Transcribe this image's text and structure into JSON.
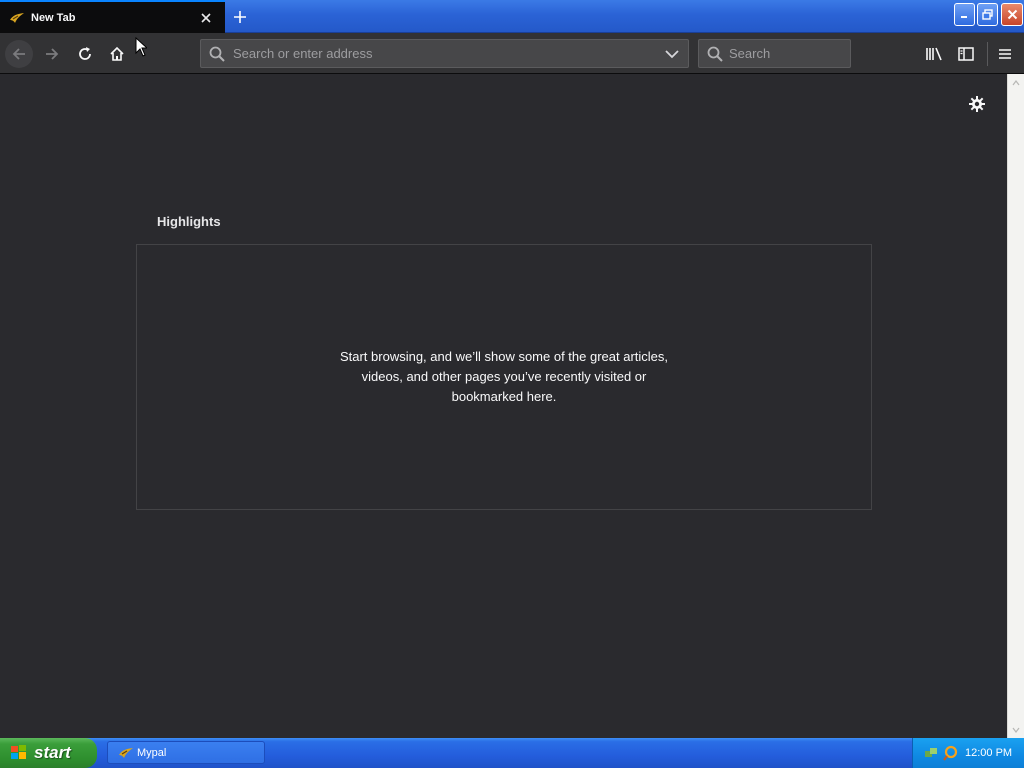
{
  "browser": {
    "tab": {
      "title": "New Tab",
      "close_glyph": "✕"
    },
    "newtab_glyph": "+",
    "urlbar": {
      "placeholder": "Search or enter address",
      "value": ""
    },
    "searchbar": {
      "placeholder": "Search",
      "value": ""
    },
    "icons": [
      "back-arrow-icon",
      "forward-arrow-icon",
      "reload-icon",
      "home-icon",
      "library-icon",
      "sidebar-icon",
      "menu-icon",
      "gear-icon"
    ],
    "theme": {
      "tab_accent": "#0a84ff",
      "content_bg": "#2a2a2e",
      "toolbar_bg": "#323234"
    }
  },
  "newtab": {
    "section_title": "Highlights",
    "empty_message": "Start browsing, and we’ll show some of the great articles, videos, and other pages you’ve recently visited or bookmarked here."
  },
  "taskbar": {
    "start_label": "start",
    "task_label": "Mypal",
    "clock": "12:00 PM"
  }
}
